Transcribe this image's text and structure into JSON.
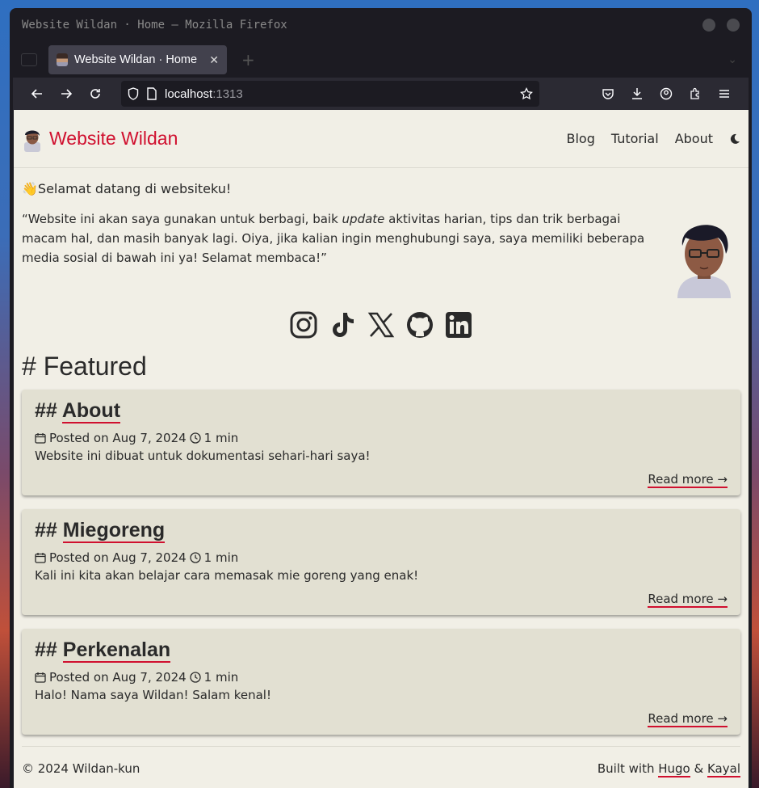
{
  "window": {
    "title": "Website Wildan · Home — Mozilla Firefox"
  },
  "tab": {
    "label": "Website Wildan · Home",
    "close": "✕"
  },
  "urlbar": {
    "host": "localhost",
    "port": ":1313"
  },
  "site": {
    "title": "Website Wildan",
    "nav": [
      "Blog",
      "Tutorial",
      "About"
    ]
  },
  "intro": {
    "welcome_emoji": "👋",
    "welcome": "Selamat datang di websiteku!",
    "quote_before": "“Website ini akan saya gunakan untuk berbagi, baik ",
    "quote_em": "update",
    "quote_after": " aktivitas harian, tips dan trik berbagai macam hal, dan masih banyak lagi. Oiya, jika kalian ingin menghubungi saya, saya memiliki beberapa media sosial di bawah ini ya! Selamat membaca!”"
  },
  "socials": [
    "instagram-icon",
    "tiktok-icon",
    "x-icon",
    "github-icon",
    "linkedin-icon"
  ],
  "featured": {
    "heading": "# Featured",
    "cards": [
      {
        "prefix": "## ",
        "title": "About",
        "meta": "Posted on Aug 7, 2024",
        "read_time": "1 min",
        "desc": "Website ini dibuat untuk dokumentasi sehari-hari saya!",
        "read_more": "Read more →"
      },
      {
        "prefix": "## ",
        "title": "Miegoreng",
        "meta": "Posted on Aug 7, 2024",
        "read_time": "1 min",
        "desc": "Kali ini kita akan belajar cara memasak mie goreng yang enak!",
        "read_more": "Read more →"
      },
      {
        "prefix": "## ",
        "title": "Perkenalan",
        "meta": "Posted on Aug 7, 2024",
        "read_time": "1 min",
        "desc": "Halo! Nama saya Wildan! Salam kenal!",
        "read_more": "Read more →"
      }
    ]
  },
  "footer": {
    "copyright": "© 2024 Wildan-kun",
    "built_prefix": "Built with ",
    "hugo": "Hugo",
    "amp": " & ",
    "kayal": "Kayal"
  },
  "colors": {
    "accent": "#d0102f",
    "page_bg": "#f1efe6",
    "card_bg": "#e2e0d2"
  }
}
